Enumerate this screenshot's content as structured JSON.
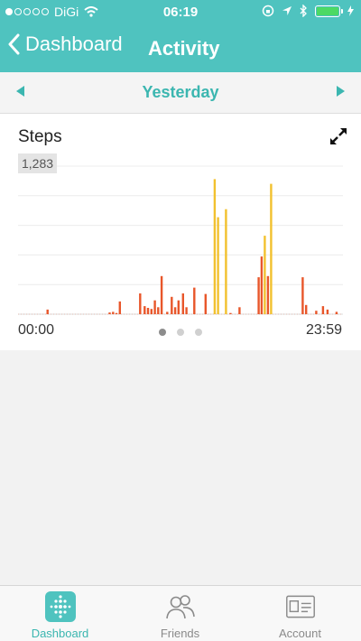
{
  "status": {
    "carrier": "DiGi",
    "time": "06:19"
  },
  "nav": {
    "back_label": "Dashboard",
    "title": "Activity"
  },
  "day_bar": {
    "label": "Yesterday"
  },
  "card": {
    "title": "Steps",
    "max_label": "1,283",
    "start_time": "00:00",
    "end_time": "23:59",
    "page_count": 3,
    "active_page": 0
  },
  "chart_data": {
    "type": "bar",
    "title": "Steps",
    "x_range": [
      "00:00",
      "23:59"
    ],
    "ylim": [
      0,
      1283
    ],
    "colors": {
      "low": "#e8562a",
      "high": "#f2c12e"
    },
    "bars": [
      {
        "x": "02:10",
        "y": 40,
        "c": "low"
      },
      {
        "x": "06:45",
        "y": 15,
        "c": "low"
      },
      {
        "x": "07:00",
        "y": 20,
        "c": "low"
      },
      {
        "x": "07:15",
        "y": 10,
        "c": "low"
      },
      {
        "x": "07:30",
        "y": 110,
        "c": "low"
      },
      {
        "x": "09:00",
        "y": 180,
        "c": "low"
      },
      {
        "x": "09:20",
        "y": 70,
        "c": "low"
      },
      {
        "x": "09:35",
        "y": 55,
        "c": "low"
      },
      {
        "x": "09:50",
        "y": 45,
        "c": "low"
      },
      {
        "x": "10:05",
        "y": 120,
        "c": "low"
      },
      {
        "x": "10:20",
        "y": 60,
        "c": "low"
      },
      {
        "x": "10:35",
        "y": 330,
        "c": "low"
      },
      {
        "x": "11:00",
        "y": 20,
        "c": "low"
      },
      {
        "x": "11:20",
        "y": 150,
        "c": "low"
      },
      {
        "x": "11:35",
        "y": 60,
        "c": "low"
      },
      {
        "x": "11:50",
        "y": 120,
        "c": "low"
      },
      {
        "x": "12:10",
        "y": 180,
        "c": "low"
      },
      {
        "x": "12:25",
        "y": 60,
        "c": "low"
      },
      {
        "x": "13:00",
        "y": 230,
        "c": "low"
      },
      {
        "x": "13:50",
        "y": 175,
        "c": "low"
      },
      {
        "x": "14:30",
        "y": 1170,
        "c": "high"
      },
      {
        "x": "14:45",
        "y": 840,
        "c": "high"
      },
      {
        "x": "15:20",
        "y": 910,
        "c": "high"
      },
      {
        "x": "15:40",
        "y": 10,
        "c": "low"
      },
      {
        "x": "16:20",
        "y": 60,
        "c": "low"
      },
      {
        "x": "17:45",
        "y": 320,
        "c": "low"
      },
      {
        "x": "17:58",
        "y": 500,
        "c": "low"
      },
      {
        "x": "18:12",
        "y": 680,
        "c": "high"
      },
      {
        "x": "18:26",
        "y": 330,
        "c": "low"
      },
      {
        "x": "18:40",
        "y": 1130,
        "c": "high"
      },
      {
        "x": "21:00",
        "y": 320,
        "c": "low"
      },
      {
        "x": "21:15",
        "y": 80,
        "c": "low"
      },
      {
        "x": "22:00",
        "y": 30,
        "c": "low"
      },
      {
        "x": "22:30",
        "y": 70,
        "c": "low"
      },
      {
        "x": "22:50",
        "y": 40,
        "c": "low"
      },
      {
        "x": "23:30",
        "y": 20,
        "c": "low"
      }
    ],
    "grid": true,
    "legend": "none"
  },
  "tabs": [
    {
      "label": "Dashboard",
      "icon": "fitbit-dots-icon",
      "active": true
    },
    {
      "label": "Friends",
      "icon": "friends-icon",
      "active": false
    },
    {
      "label": "Account",
      "icon": "account-card-icon",
      "active": false
    }
  ],
  "colors": {
    "accent": "#4fc3bf",
    "accent_text": "#3bb6b0"
  }
}
